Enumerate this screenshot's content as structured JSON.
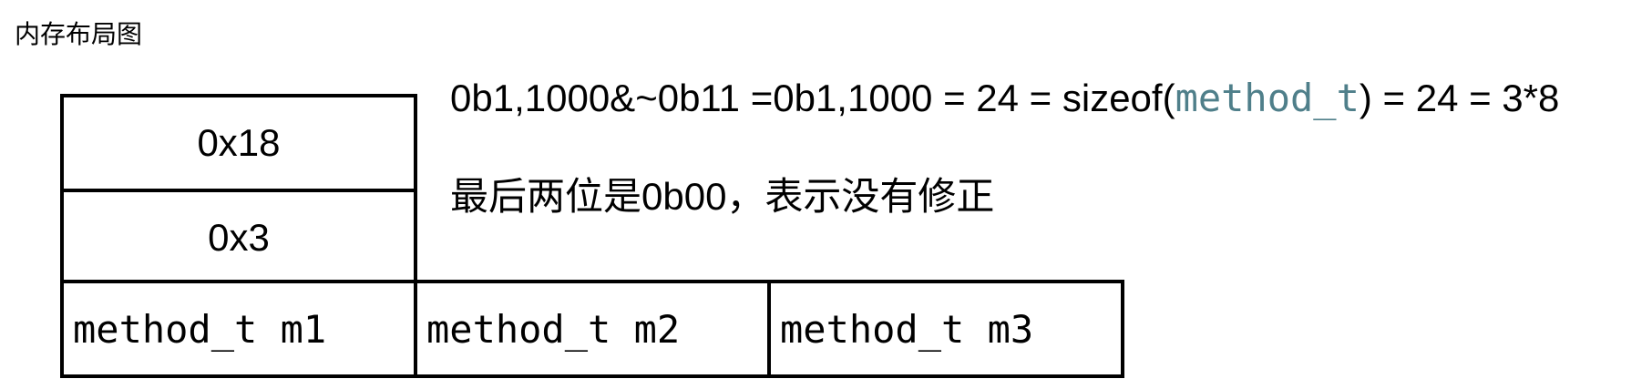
{
  "title": "内存布局图",
  "colors": {
    "code_highlight": "#4f7f8a",
    "border": "#000000"
  },
  "blocks": {
    "header": [
      "0x18",
      "0x3"
    ],
    "methods": [
      "method_t m1",
      "method_t m2",
      "method_t m3"
    ]
  },
  "notes": {
    "line1_prefix": "0b1,1000&~0b11 =0b1,1000  = 24 = sizeof(",
    "line1_code": "method_t",
    "line1_suffix": ") = 24 = 3*8",
    "line2": "最后两位是0b00，表示没有修正"
  }
}
